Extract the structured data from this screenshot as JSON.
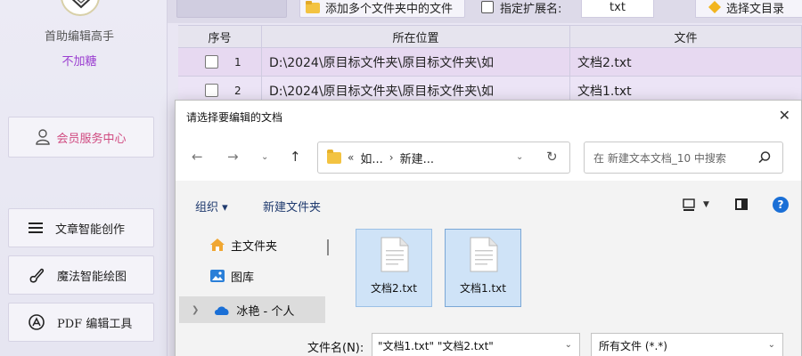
{
  "sidebar": {
    "app_name": "首助编辑高手",
    "app_tag": "不加糖",
    "member_center": "会员服务中心",
    "nav": [
      {
        "label": "文章智能创作"
      },
      {
        "label": "魔法智能绘图"
      },
      {
        "label": "PDF 编辑工具"
      }
    ]
  },
  "toolbar": {
    "add_multi_label": "添加多个文件夹中的文件",
    "ext_checkbox_label": "指定扩展名:",
    "ext_value": "txt",
    "output_label": "选择文目录"
  },
  "grid": {
    "columns": [
      "序号",
      "所在位置",
      "文件"
    ],
    "rows": [
      {
        "idx": "1",
        "location": "D:\\2024\\原目标文件夹\\原目标文件夹\\如",
        "name": "文档2.txt"
      },
      {
        "idx": "2",
        "location": "D:\\2024\\原目标文件夹\\原目标文件夹\\如",
        "name": "文档1.txt"
      }
    ]
  },
  "dialog": {
    "title": "请选择要编辑的文档",
    "close": "✕",
    "address": {
      "prefix": "«",
      "crumbs": [
        "如...",
        "新建..."
      ]
    },
    "search_placeholder": "在 新建文本文档_10 中搜索",
    "commands": {
      "organize": "组织 ▾",
      "new_folder": "新建文件夹"
    },
    "nav_pane": [
      {
        "label": "主文件夹",
        "icon": "home-icon"
      },
      {
        "label": "图库",
        "icon": "gallery-icon"
      },
      {
        "label": "冰艳 - 个人",
        "icon": "cloud-icon"
      }
    ],
    "files": [
      {
        "name": "文档2.txt"
      },
      {
        "name": "文档1.txt"
      }
    ],
    "filename_label": "文件名(N):",
    "filename_value": "\"文档1.txt\" \"文档2.txt\"",
    "filetype_value": "所有文件 (*.*)"
  },
  "colors": {
    "accent_purple": "#9b3fd0",
    "member_pink": "#d04a80",
    "selection_blue": "#cfe3f7",
    "help_blue": "#1a6fd6"
  }
}
